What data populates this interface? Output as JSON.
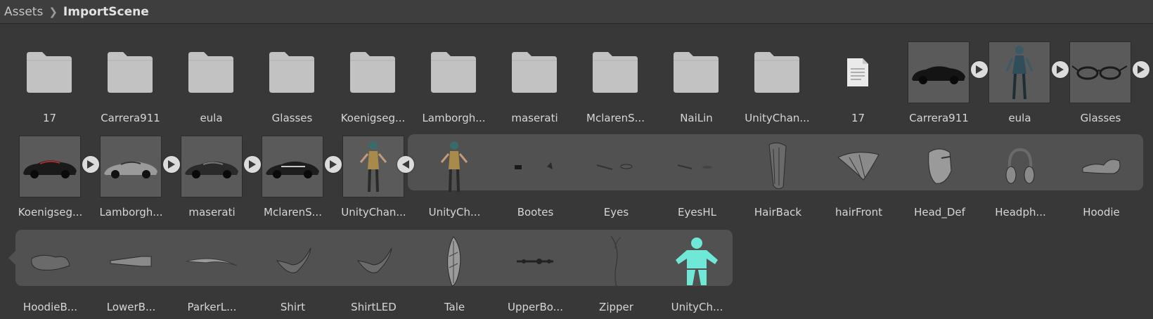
{
  "breadcrumb": {
    "root": "Assets",
    "current": "ImportScene"
  },
  "row1": [
    {
      "label": "17",
      "kind": "folder"
    },
    {
      "label": "Carrera911",
      "kind": "folder"
    },
    {
      "label": "eula",
      "kind": "folder"
    },
    {
      "label": "Glasses",
      "kind": "folder"
    },
    {
      "label": "Koenigseg...",
      "kind": "folder"
    },
    {
      "label": "Lamborgh...",
      "kind": "folder"
    },
    {
      "label": "maserati",
      "kind": "folder"
    },
    {
      "label": "MclarenS...",
      "kind": "folder"
    },
    {
      "label": "NaiLin",
      "kind": "folder"
    },
    {
      "label": "UnityChan...",
      "kind": "folder"
    },
    {
      "label": "17",
      "kind": "file"
    },
    {
      "label": "Carrera911",
      "kind": "car-model"
    },
    {
      "label": "eula",
      "kind": "character-model"
    },
    {
      "label": "Glasses",
      "kind": "glasses-model"
    }
  ],
  "row2_models": [
    {
      "label": "Koenigseg...",
      "kind": "car-model"
    },
    {
      "label": "Lamborgh...",
      "kind": "car-model"
    },
    {
      "label": "maserati",
      "kind": "car-model"
    },
    {
      "label": "MclarenS...",
      "kind": "car-model"
    },
    {
      "label": "UnityChan...",
      "kind": "character-model"
    }
  ],
  "row2_group": [
    {
      "label": "UnityCh...",
      "kind": "character-model"
    },
    {
      "label": "Bootes",
      "kind": "mesh"
    },
    {
      "label": "Eyes",
      "kind": "mesh"
    },
    {
      "label": "EyesHL",
      "kind": "mesh"
    },
    {
      "label": "HairBack",
      "kind": "mesh"
    },
    {
      "label": "hairFront",
      "kind": "mesh"
    },
    {
      "label": "Head_Def",
      "kind": "mesh"
    },
    {
      "label": "Headph...",
      "kind": "mesh"
    },
    {
      "label": "Hoodie",
      "kind": "mesh"
    }
  ],
  "row3_group": [
    {
      "label": "HoodieB...",
      "kind": "mesh"
    },
    {
      "label": "LowerB...",
      "kind": "mesh"
    },
    {
      "label": "ParkerL...",
      "kind": "mesh"
    },
    {
      "label": "Shirt",
      "kind": "mesh"
    },
    {
      "label": "ShirtLED",
      "kind": "mesh"
    },
    {
      "label": "Tale",
      "kind": "mesh"
    },
    {
      "label": "UpperBo...",
      "kind": "mesh"
    },
    {
      "label": "Zipper",
      "kind": "mesh"
    },
    {
      "label": "UnityCh...",
      "kind": "avatar"
    }
  ],
  "colors": {
    "background": "#383838",
    "group": "#515151",
    "folder": "#c2c2c2",
    "avatar": "#6fe8d8"
  }
}
